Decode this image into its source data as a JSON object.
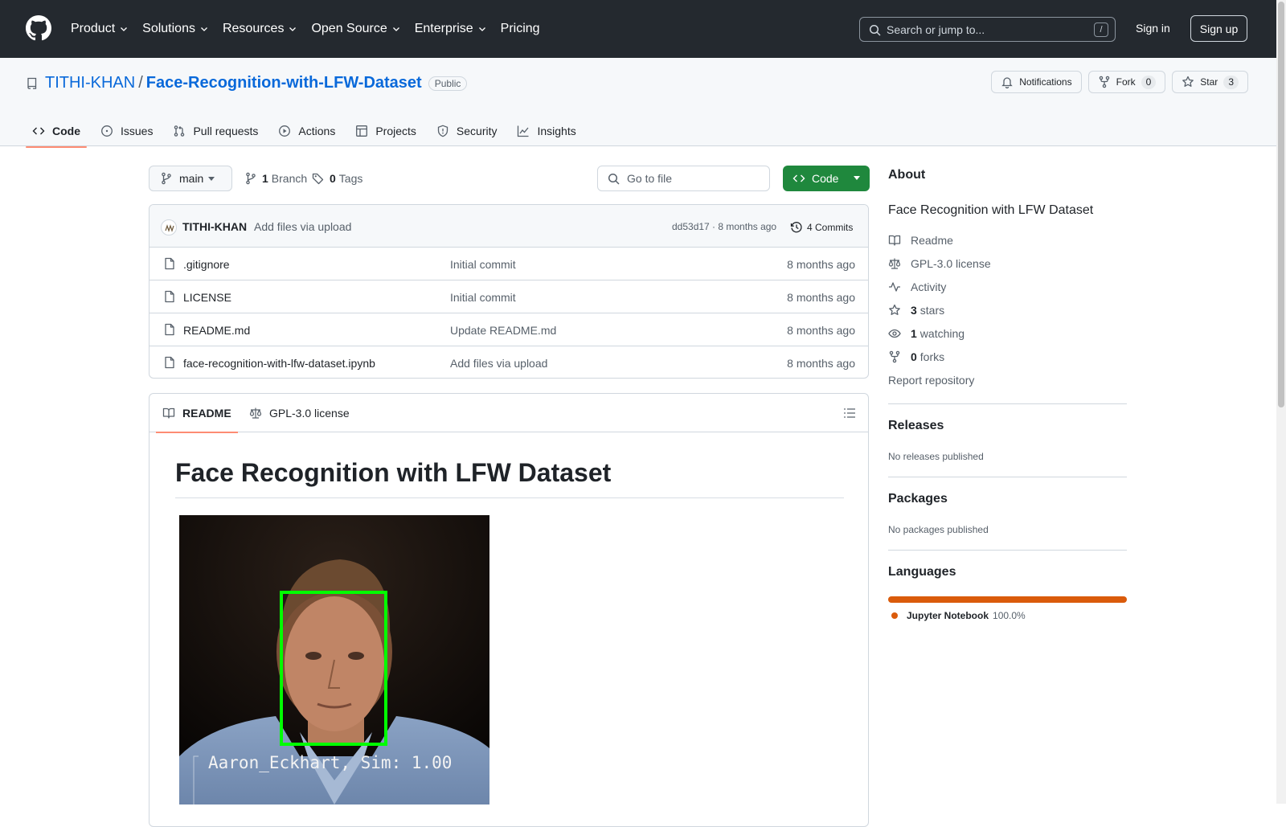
{
  "header": {
    "nav": [
      "Product",
      "Solutions",
      "Resources",
      "Open Source",
      "Enterprise",
      "Pricing"
    ],
    "search_placeholder": "Search or jump to...",
    "search_shortcut": "/",
    "sign_in": "Sign in",
    "sign_up": "Sign up"
  },
  "repo": {
    "owner": "TITHI-KHAN",
    "separator": "/",
    "name": "Face-Recognition-with-LFW-Dataset",
    "visibility": "Public",
    "notifications_label": "Notifications",
    "fork_label": "Fork",
    "fork_count": "0",
    "star_label": "Star",
    "star_count": "3"
  },
  "tabs": [
    "Code",
    "Issues",
    "Pull requests",
    "Actions",
    "Projects",
    "Security",
    "Insights"
  ],
  "toolbar": {
    "branch": "main",
    "branch_count": "1",
    "branch_label": "Branch",
    "tag_count": "0",
    "tag_label": "Tags",
    "goto_placeholder": "Go to file",
    "code_button": "Code"
  },
  "commit": {
    "author": "TITHI-KHAN",
    "message": "Add files via upload",
    "hash_time": "dd53d17 · 8 months ago",
    "commits": "4 Commits"
  },
  "files": [
    {
      "name": ".gitignore",
      "message": "Initial commit",
      "age": "8 months ago"
    },
    {
      "name": "LICENSE",
      "message": "Initial commit",
      "age": "8 months ago"
    },
    {
      "name": "README.md",
      "message": "Update README.md",
      "age": "8 months ago"
    },
    {
      "name": "face-recognition-with-lfw-dataset.ipynb",
      "message": "Add files via upload",
      "age": "8 months ago"
    }
  ],
  "readme": {
    "tab_readme": "README",
    "tab_license": "GPL-3.0 license",
    "heading": "Face Recognition with LFW Dataset",
    "image_caption": "Aaron_Eckhart, Sim: 1.00"
  },
  "about": {
    "title": "About",
    "description": "Face Recognition with LFW Dataset",
    "readme": "Readme",
    "license": "GPL-3.0 license",
    "activity": "Activity",
    "stars_count": "3",
    "stars_label": "stars",
    "watching_count": "1",
    "watching_label": "watching",
    "forks_count": "0",
    "forks_label": "forks",
    "report": "Report repository"
  },
  "releases": {
    "title": "Releases",
    "text": "No releases published"
  },
  "packages": {
    "title": "Packages",
    "text": "No packages published"
  },
  "languages": {
    "title": "Languages",
    "name": "Jupyter Notebook",
    "percent": "100.0%",
    "color": "#da5b0b",
    "fraction": 1.0
  },
  "colors": {
    "header_bg": "#24292f",
    "link": "#0969da",
    "green_button": "#1f883d",
    "tab_underline": "#fd8c73",
    "face_box": "#00ff00"
  }
}
